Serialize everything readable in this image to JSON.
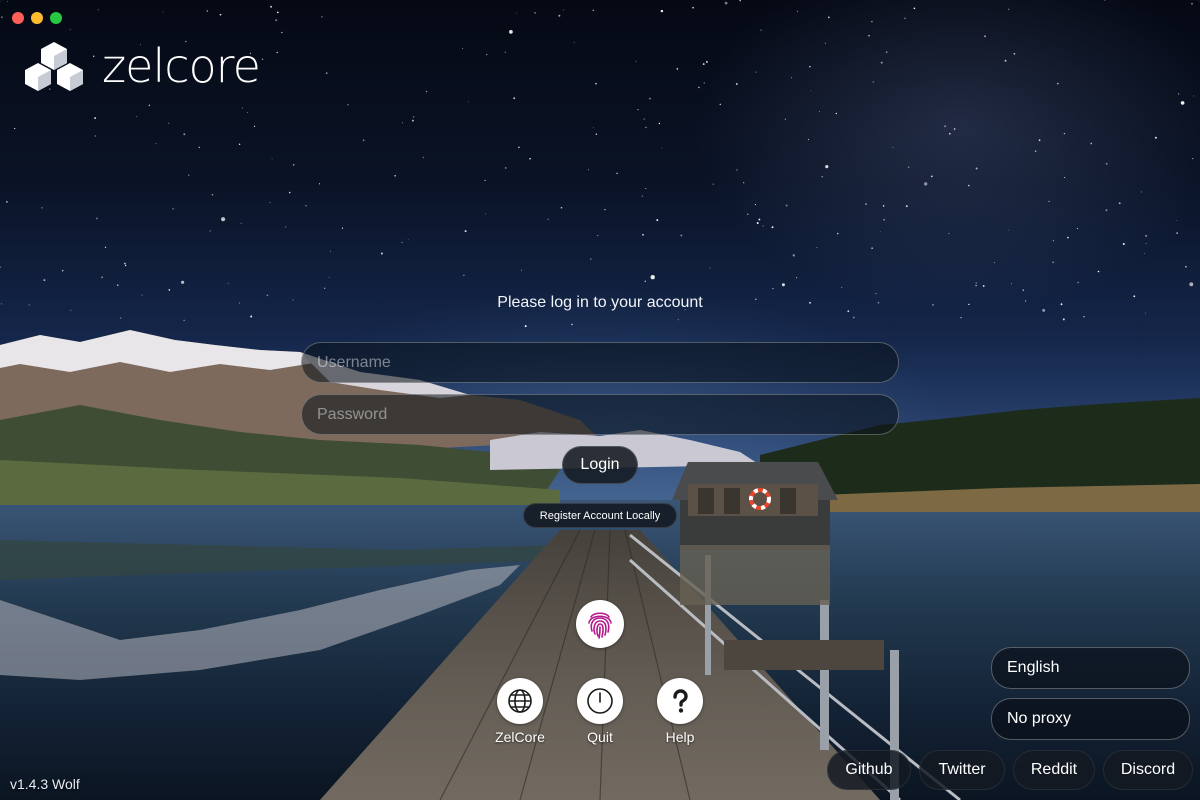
{
  "app": {
    "logo_text": "zelcore",
    "version": "v1.4.3 Wolf"
  },
  "login": {
    "prompt": "Please log in to your account",
    "username_placeholder": "Username",
    "password_placeholder": "Password",
    "login_label": "Login",
    "register_label": "Register Account Locally"
  },
  "actions": [
    {
      "label": "ZelCore",
      "icon": "globe-icon"
    },
    {
      "label": "Quit",
      "icon": "power-icon"
    },
    {
      "label": "Help",
      "icon": "question-icon"
    }
  ],
  "fingerprint": {
    "icon": "fingerprint-icon"
  },
  "settings": {
    "language": "English",
    "proxy": "No proxy"
  },
  "links": [
    "Github",
    "Twitter",
    "Reddit",
    "Discord"
  ],
  "colors": {
    "close": "#fe5f57",
    "minimize": "#febc2e",
    "maximize": "#28c840",
    "fingerprint": "#b21a8c"
  }
}
